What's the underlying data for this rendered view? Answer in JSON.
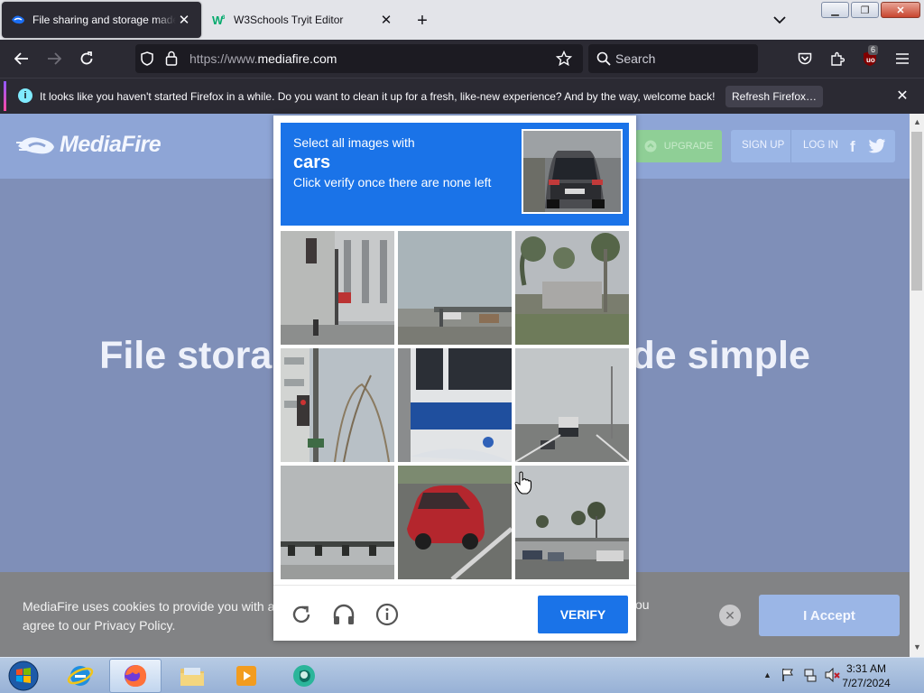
{
  "browser": {
    "tabs": [
      {
        "title": "File sharing and storage made s",
        "active": true
      },
      {
        "title": "W3Schools Tryit Editor",
        "active": false
      }
    ],
    "url_prefix": "https://www.",
    "url_domain": "mediafire.com",
    "search_placeholder": "Search",
    "badge_count": "6",
    "notification": {
      "message": "It looks like you haven't started Firefox in a while. Do you want to clean it up for a fresh, like-new experience? And by the way, welcome back!",
      "button": "Refresh Firefox…"
    }
  },
  "page": {
    "logo": "MediaFire",
    "upgrade": "UPGRADE",
    "signup": "SIGN UP",
    "login": "LOG IN",
    "hero_left": "File storag",
    "hero_right": "de simple",
    "cookie_text": "MediaFire uses cookies to provide you with a p agree to our Privacy Policy.",
    "cookie_tail": "ou",
    "accept": "I Accept"
  },
  "captcha": {
    "instruction_line1": "Select all images with",
    "target": "cars",
    "instruction_line3": "Click verify once there are none left",
    "verify": "VERIFY"
  },
  "taskbar": {
    "time": "3:31 AM",
    "date": "7/27/2024"
  },
  "colors": {
    "captcha_blue": "#1a73e8",
    "firefox_dark": "#2b2a33",
    "mediafire_blue": "#8ea5d6"
  }
}
